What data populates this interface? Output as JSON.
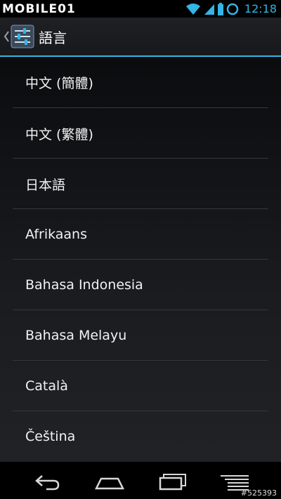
{
  "status_bar": {
    "watermark": "MOBILE01",
    "time": "12:18"
  },
  "action_bar": {
    "title": "語言",
    "icon": "settings-sliders-icon"
  },
  "languages": [
    "中文 (簡體)",
    "中文 (繁體)",
    "日本語",
    "Afrikaans",
    "Bahasa Indonesia",
    "Bahasa Melayu",
    "Català",
    "Čeština"
  ],
  "nav_bar": {
    "icons": [
      "back-icon",
      "home-icon",
      "recent-apps-icon",
      "menu-icon"
    ]
  },
  "watermark_id": "#525393",
  "colors": {
    "accent": "#33b5e5",
    "background": "#1a1c20",
    "divider": "#34373c"
  }
}
